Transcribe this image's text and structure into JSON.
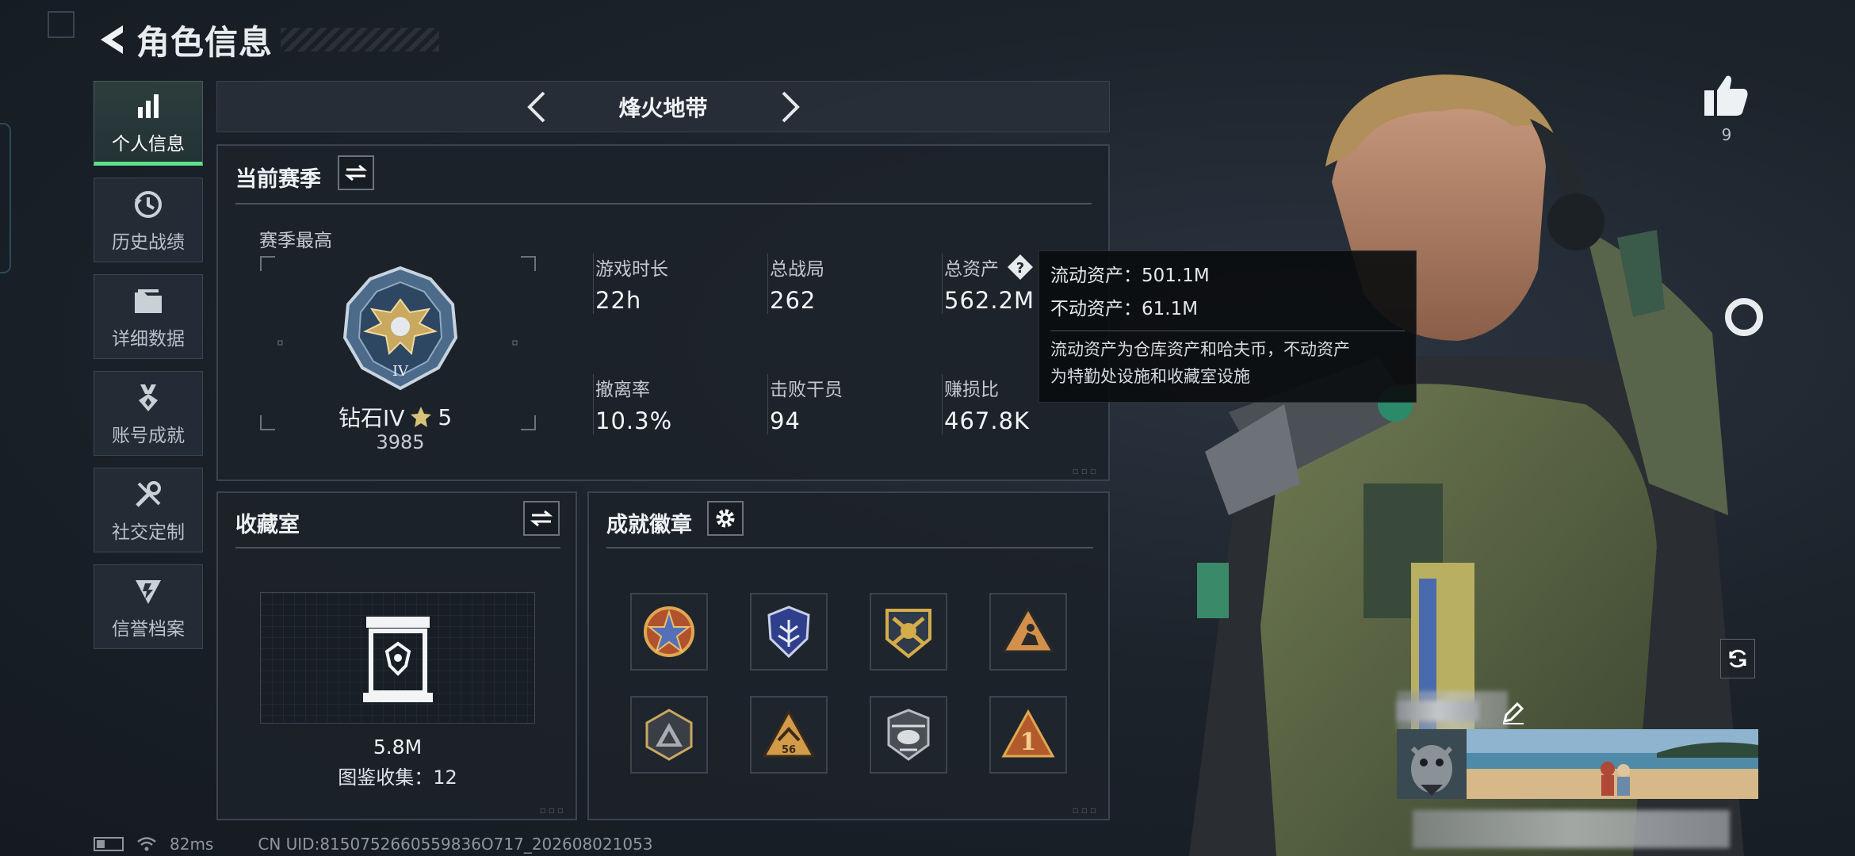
{
  "header": {
    "title": "角色信息"
  },
  "nav": [
    {
      "label": "个人信息",
      "icon": "bar-chart-icon",
      "active": true
    },
    {
      "label": "历史战绩",
      "icon": "history-clock-icon"
    },
    {
      "label": "详细数据",
      "icon": "folder-icon"
    },
    {
      "label": "账号成就",
      "icon": "medal-icon"
    },
    {
      "label": "社交定制",
      "icon": "tools-icon"
    },
    {
      "label": "信誉档案",
      "icon": "shield-lightning-icon"
    }
  ],
  "mode": {
    "title": "烽火地带"
  },
  "season": {
    "title": "当前赛季",
    "sub_title": "赛季最高",
    "rank_name": "钻石IV",
    "rank_stars": "5",
    "rank_score": "3985",
    "rank_medal_numeral": "IV",
    "stats": [
      {
        "label": "游戏时长",
        "value": "22h"
      },
      {
        "label": "总战局",
        "value": "262"
      },
      {
        "label": "总资产",
        "value": "562.2M"
      },
      {
        "label": "撤离率",
        "value": "10.3%"
      },
      {
        "label": "击败干员",
        "value": "94"
      },
      {
        "label": "赚损比",
        "value": "467.8K"
      }
    ]
  },
  "tooltip": {
    "liquid": "流动资产：501.1M",
    "fixed": "不动资产：61.1M",
    "desc_line1": "流动资产为仓库资产和哈夫币，不动资产",
    "desc_line2": "为特勤处设施和收藏室设施"
  },
  "collection": {
    "title": "收藏室",
    "value": "5.8M",
    "count_text": "图鉴收集：12"
  },
  "badges": {
    "title": "成就徽章",
    "items": [
      {
        "name": "star-compass-badge",
        "color": "#c9883a"
      },
      {
        "name": "shield-wings-badge",
        "color": "#5b6fb0"
      },
      {
        "name": "crossed-guns-badge",
        "color": "#c9a23a"
      },
      {
        "name": "triangle-figure-badge",
        "color": "#c98a3a"
      },
      {
        "name": "mountain-hex-badge",
        "color": "#8a8f95"
      },
      {
        "name": "triangle-56-badge",
        "color": "#d09a4a",
        "text": "56"
      },
      {
        "name": "helicopter-badge",
        "color": "#9a9ea3"
      },
      {
        "name": "triangle-1-badge",
        "color": "#c9883a",
        "text": "1"
      }
    ]
  },
  "likes": {
    "count": "9"
  },
  "status": {
    "ping": "82ms",
    "uid": "CN UID:8150752660559836O717_202608021053"
  },
  "colors": {
    "accent_green": "#5fe08a",
    "gold": "#c9a23a"
  }
}
